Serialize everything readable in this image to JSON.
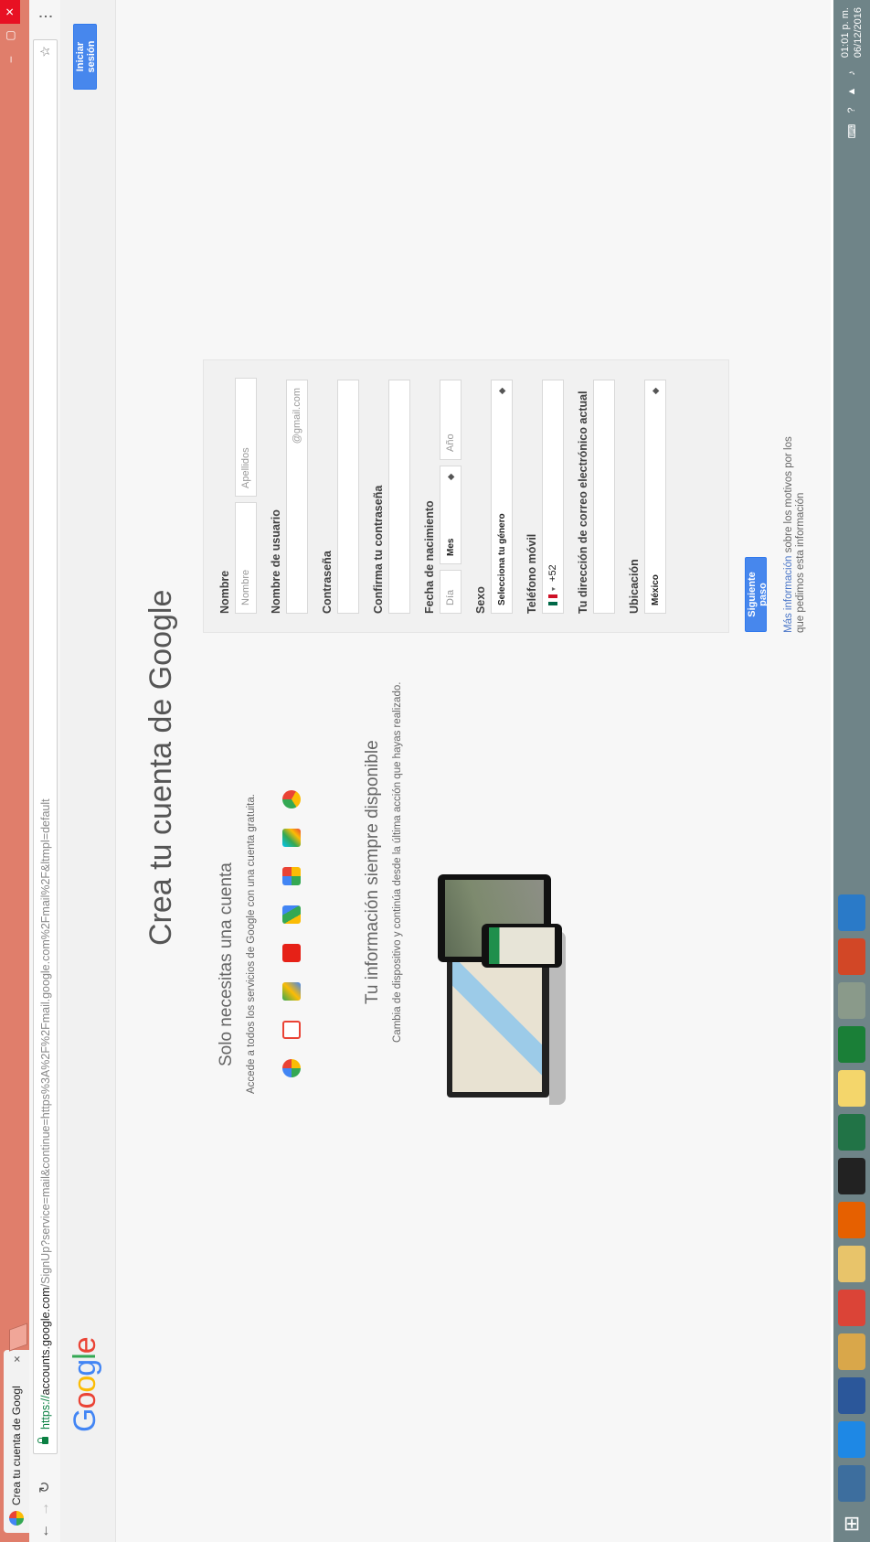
{
  "browser": {
    "tab_title": "Crea tu cuenta de Googl",
    "tab_close": "×",
    "url_scheme": "https://",
    "url_host": "accounts.google.com",
    "url_rest": "/SignUp?service=mail&continue=https%3A%2F%2Fmail.google.com%2Fmail%2F&ltmpl=default",
    "window_controls": [
      "–",
      "▢",
      "✕"
    ]
  },
  "header": {
    "logo": "Google",
    "signin_label": "Iniciar sesión"
  },
  "main": {
    "title": "Crea tu cuenta de Google",
    "section1_title": "Solo necesitas una cuenta",
    "section1_text": "Accede a todos los servicios de Google con una cuenta gratuita.",
    "section2_title": "Tu información siempre disponible",
    "section2_text": "Cambia de dispositivo y continúa desde la última acción que hayas realizado.",
    "service_icons": [
      "google-icon",
      "gmail-icon",
      "maps-icon",
      "youtube-icon",
      "drive-icon",
      "photos-icon",
      "play-icon",
      "chrome-icon"
    ]
  },
  "form": {
    "name_label": "Nombre",
    "first_name_placeholder": "Nombre",
    "last_name_placeholder": "Apellidos",
    "username_label": "Nombre de usuario",
    "username_suffix": "@gmail.com",
    "password_label": "Contraseña",
    "confirm_label": "Confirma tu contraseña",
    "birth_label": "Fecha de nacimiento",
    "day_placeholder": "Día",
    "month_value": "Mes",
    "year_placeholder": "Año",
    "gender_label": "Sexo",
    "gender_value": "Selecciona tu género",
    "phone_label": "Teléfono móvil",
    "phone_prefix": "+52",
    "email_label": "Tu dirección de correo electrónico actual",
    "location_label": "Ubicación",
    "location_value": "México",
    "next_label": "Siguiente paso",
    "more_link": "Más información",
    "more_text": " sobre los motivos por los que pedimos esta información"
  },
  "taskbar": {
    "time": "01:01 p. m.",
    "date": "06/12/2016"
  },
  "colors": {
    "accent": "#4787ed",
    "titlebar": "#e07e6b",
    "taskbar": "#6f8488"
  }
}
